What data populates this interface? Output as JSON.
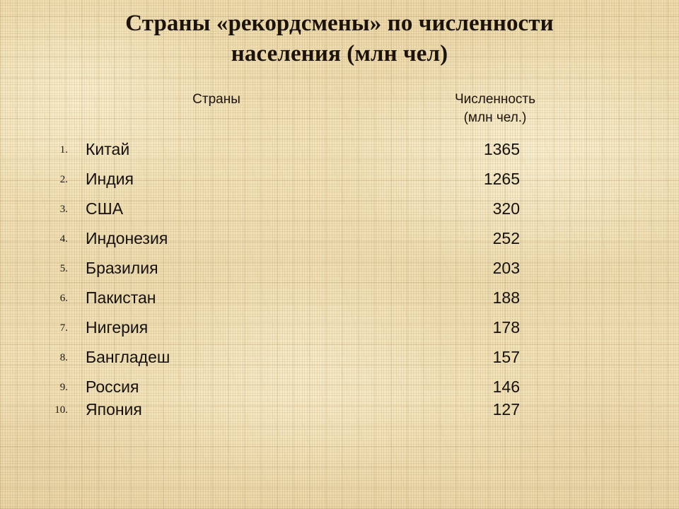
{
  "slide": {
    "title_lines": [
      "Страны «рекордсмены» по численности",
      "населения (млн чел)"
    ],
    "background_color": "#ebd7a4",
    "text_color": "#151008"
  },
  "table": {
    "headers": {
      "countries": "Страны",
      "population_line1": "Численность",
      "population_line2": "(млн чел.)"
    },
    "rows": [
      {
        "rank": "1.",
        "country": "Китай",
        "value": "1365"
      },
      {
        "rank": "2.",
        "country": "Индия",
        "value": "1265"
      },
      {
        "rank": "3.",
        "country": "США",
        "value": "320"
      },
      {
        "rank": "4.",
        "country": "Индонезия",
        "value": "252"
      },
      {
        "rank": "5.",
        "country": "Бразилия",
        "value": "203"
      },
      {
        "rank": "6.",
        "country": "Пакистан",
        "value": "188"
      },
      {
        "rank": "7.",
        "country": "Нигерия",
        "value": "178"
      },
      {
        "rank": "8.",
        "country": "Бангладеш",
        "value": "157"
      },
      {
        "rank": "9.",
        "country": "Россия",
        "value": "146"
      },
      {
        "rank": "10.",
        "country": "Япония",
        "value": "127"
      }
    ]
  },
  "chart_data": {
    "type": "table",
    "title": "Страны «рекордсмены» по численности населения (млн чел)",
    "columns": [
      "Страны",
      "Численность (млн чел.)"
    ],
    "categories": [
      "Китай",
      "Индия",
      "США",
      "Индонезия",
      "Бразилия",
      "Пакистан",
      "Нигерия",
      "Бангладеш",
      "Россия",
      "Япония"
    ],
    "values": [
      1365,
      1265,
      320,
      252,
      203,
      188,
      178,
      157,
      146,
      127
    ],
    "ylabel": "Численность (млн чел.)",
    "xlabel": "Страны"
  }
}
